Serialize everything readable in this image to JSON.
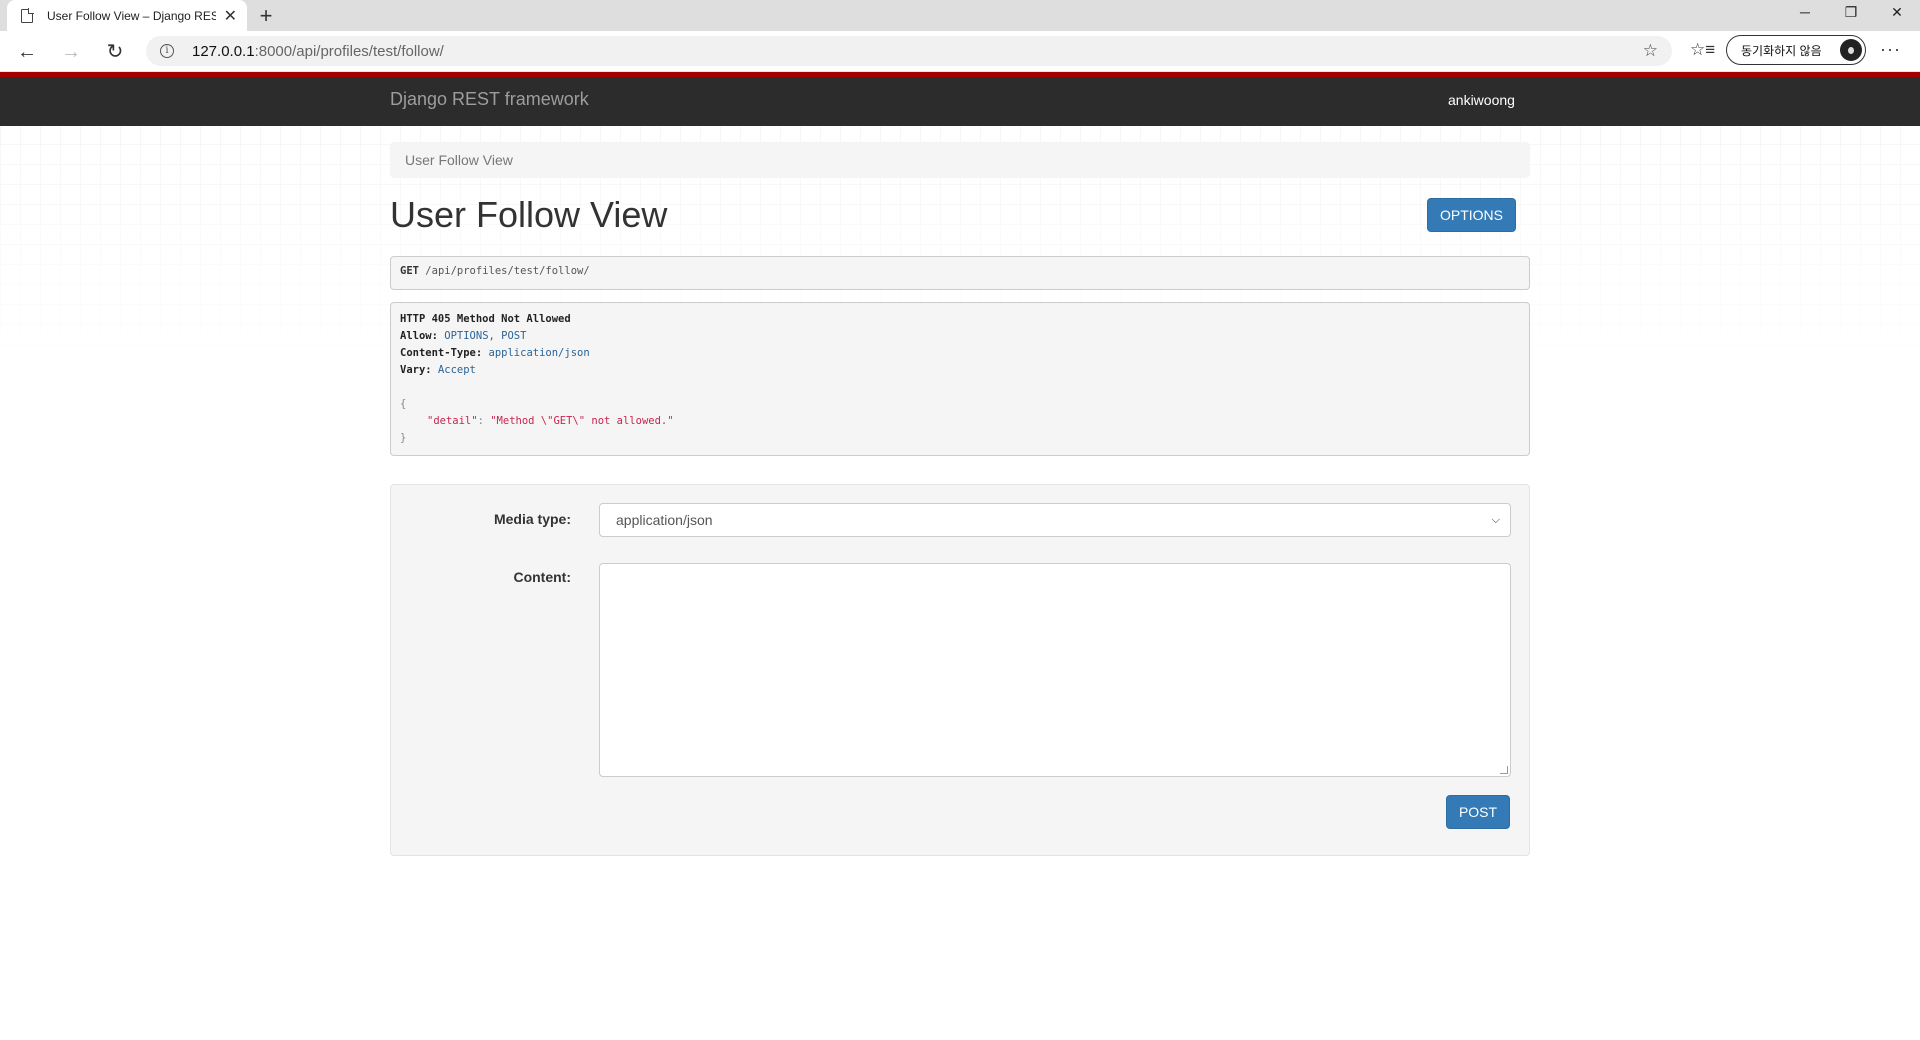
{
  "browser": {
    "tab_title": "User Follow View – Django REST",
    "url_host": "127.0.0.1",
    "url_path": ":8000/api/profiles/test/follow/",
    "profile_label": "동기화하지 않음"
  },
  "navbar": {
    "brand": "Django REST framework",
    "user": "ankiwoong"
  },
  "breadcrumb": "User Follow View",
  "page_title": "User Follow View",
  "options_button": "OPTIONS",
  "request": {
    "method": "GET",
    "path": "/api/profiles/test/follow/"
  },
  "response": {
    "status_line": "HTTP 405 Method Not Allowed",
    "headers": [
      {
        "key": "Allow:",
        "value": "OPTIONS, POST"
      },
      {
        "key": "Content-Type:",
        "value": "application/json"
      },
      {
        "key": "Vary:",
        "value": "Accept"
      }
    ],
    "body_open": "{",
    "body_key": "\"detail\"",
    "body_sep": ": ",
    "body_value": "\"Method \\\"GET\\\" not allowed.\"",
    "body_close": "}"
  },
  "form": {
    "media_type_label": "Media type:",
    "media_type_value": "application/json",
    "content_label": "Content:",
    "content_value": "",
    "post_button": "POST"
  },
  "colors": {
    "navbar_bg": "#2c2c2c",
    "navbar_accent": "#a30000",
    "button_primary": "#337ab7"
  }
}
